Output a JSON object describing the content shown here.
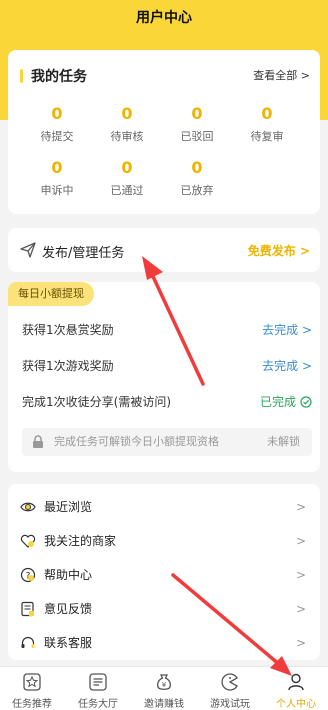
{
  "header": {
    "title": "用户中心"
  },
  "tasks": {
    "title": "我的任务",
    "view_all": "查看全部 >",
    "stats": [
      {
        "value": "0",
        "label": "待提交"
      },
      {
        "value": "0",
        "label": "待审核"
      },
      {
        "value": "0",
        "label": "已驳回"
      },
      {
        "value": "0",
        "label": "待复审"
      },
      {
        "value": "0",
        "label": "申诉中"
      },
      {
        "value": "0",
        "label": "已通过"
      },
      {
        "value": "0",
        "label": "已放弃"
      }
    ]
  },
  "publish": {
    "label": "发布/管理任务",
    "action": "免费发布 >"
  },
  "daily": {
    "badge": "每日小额提现",
    "rows": [
      {
        "label": "获得1次悬赏奖励",
        "status": "去完成 >"
      },
      {
        "label": "获得1次游戏奖励",
        "status": "去完成 >"
      },
      {
        "label": "完成1次收徒分享(需被访问)",
        "status": "已完成"
      }
    ],
    "unlock_text": "完成任务可解锁今日小额提现资格",
    "unlock_status": "未解锁"
  },
  "menu": {
    "items": [
      {
        "label": "最近浏览",
        "icon": "eye-icon"
      },
      {
        "label": "我关注的商家",
        "icon": "heart-icon"
      },
      {
        "label": "帮助中心",
        "icon": "question-icon"
      },
      {
        "label": "意见反馈",
        "icon": "feedback-icon"
      },
      {
        "label": "联系客服",
        "icon": "headset-icon"
      }
    ],
    "chevron": ">"
  },
  "bottom_nav": {
    "items": [
      {
        "label": "任务推荐",
        "icon": "star-icon"
      },
      {
        "label": "任务大厅",
        "icon": "list-icon"
      },
      {
        "label": "邀请赚钱",
        "icon": "money-bag-icon"
      },
      {
        "label": "游戏试玩",
        "icon": "game-icon"
      },
      {
        "label": "个人中心",
        "icon": "user-icon"
      }
    ],
    "active_index": 4
  },
  "colors": {
    "brand_yellow": "#fbd638",
    "stat_number": "#f0b400",
    "link_blue": "#3a8ccf",
    "done_green": "#2aa35a",
    "annotation_red": "#f23b3b"
  }
}
